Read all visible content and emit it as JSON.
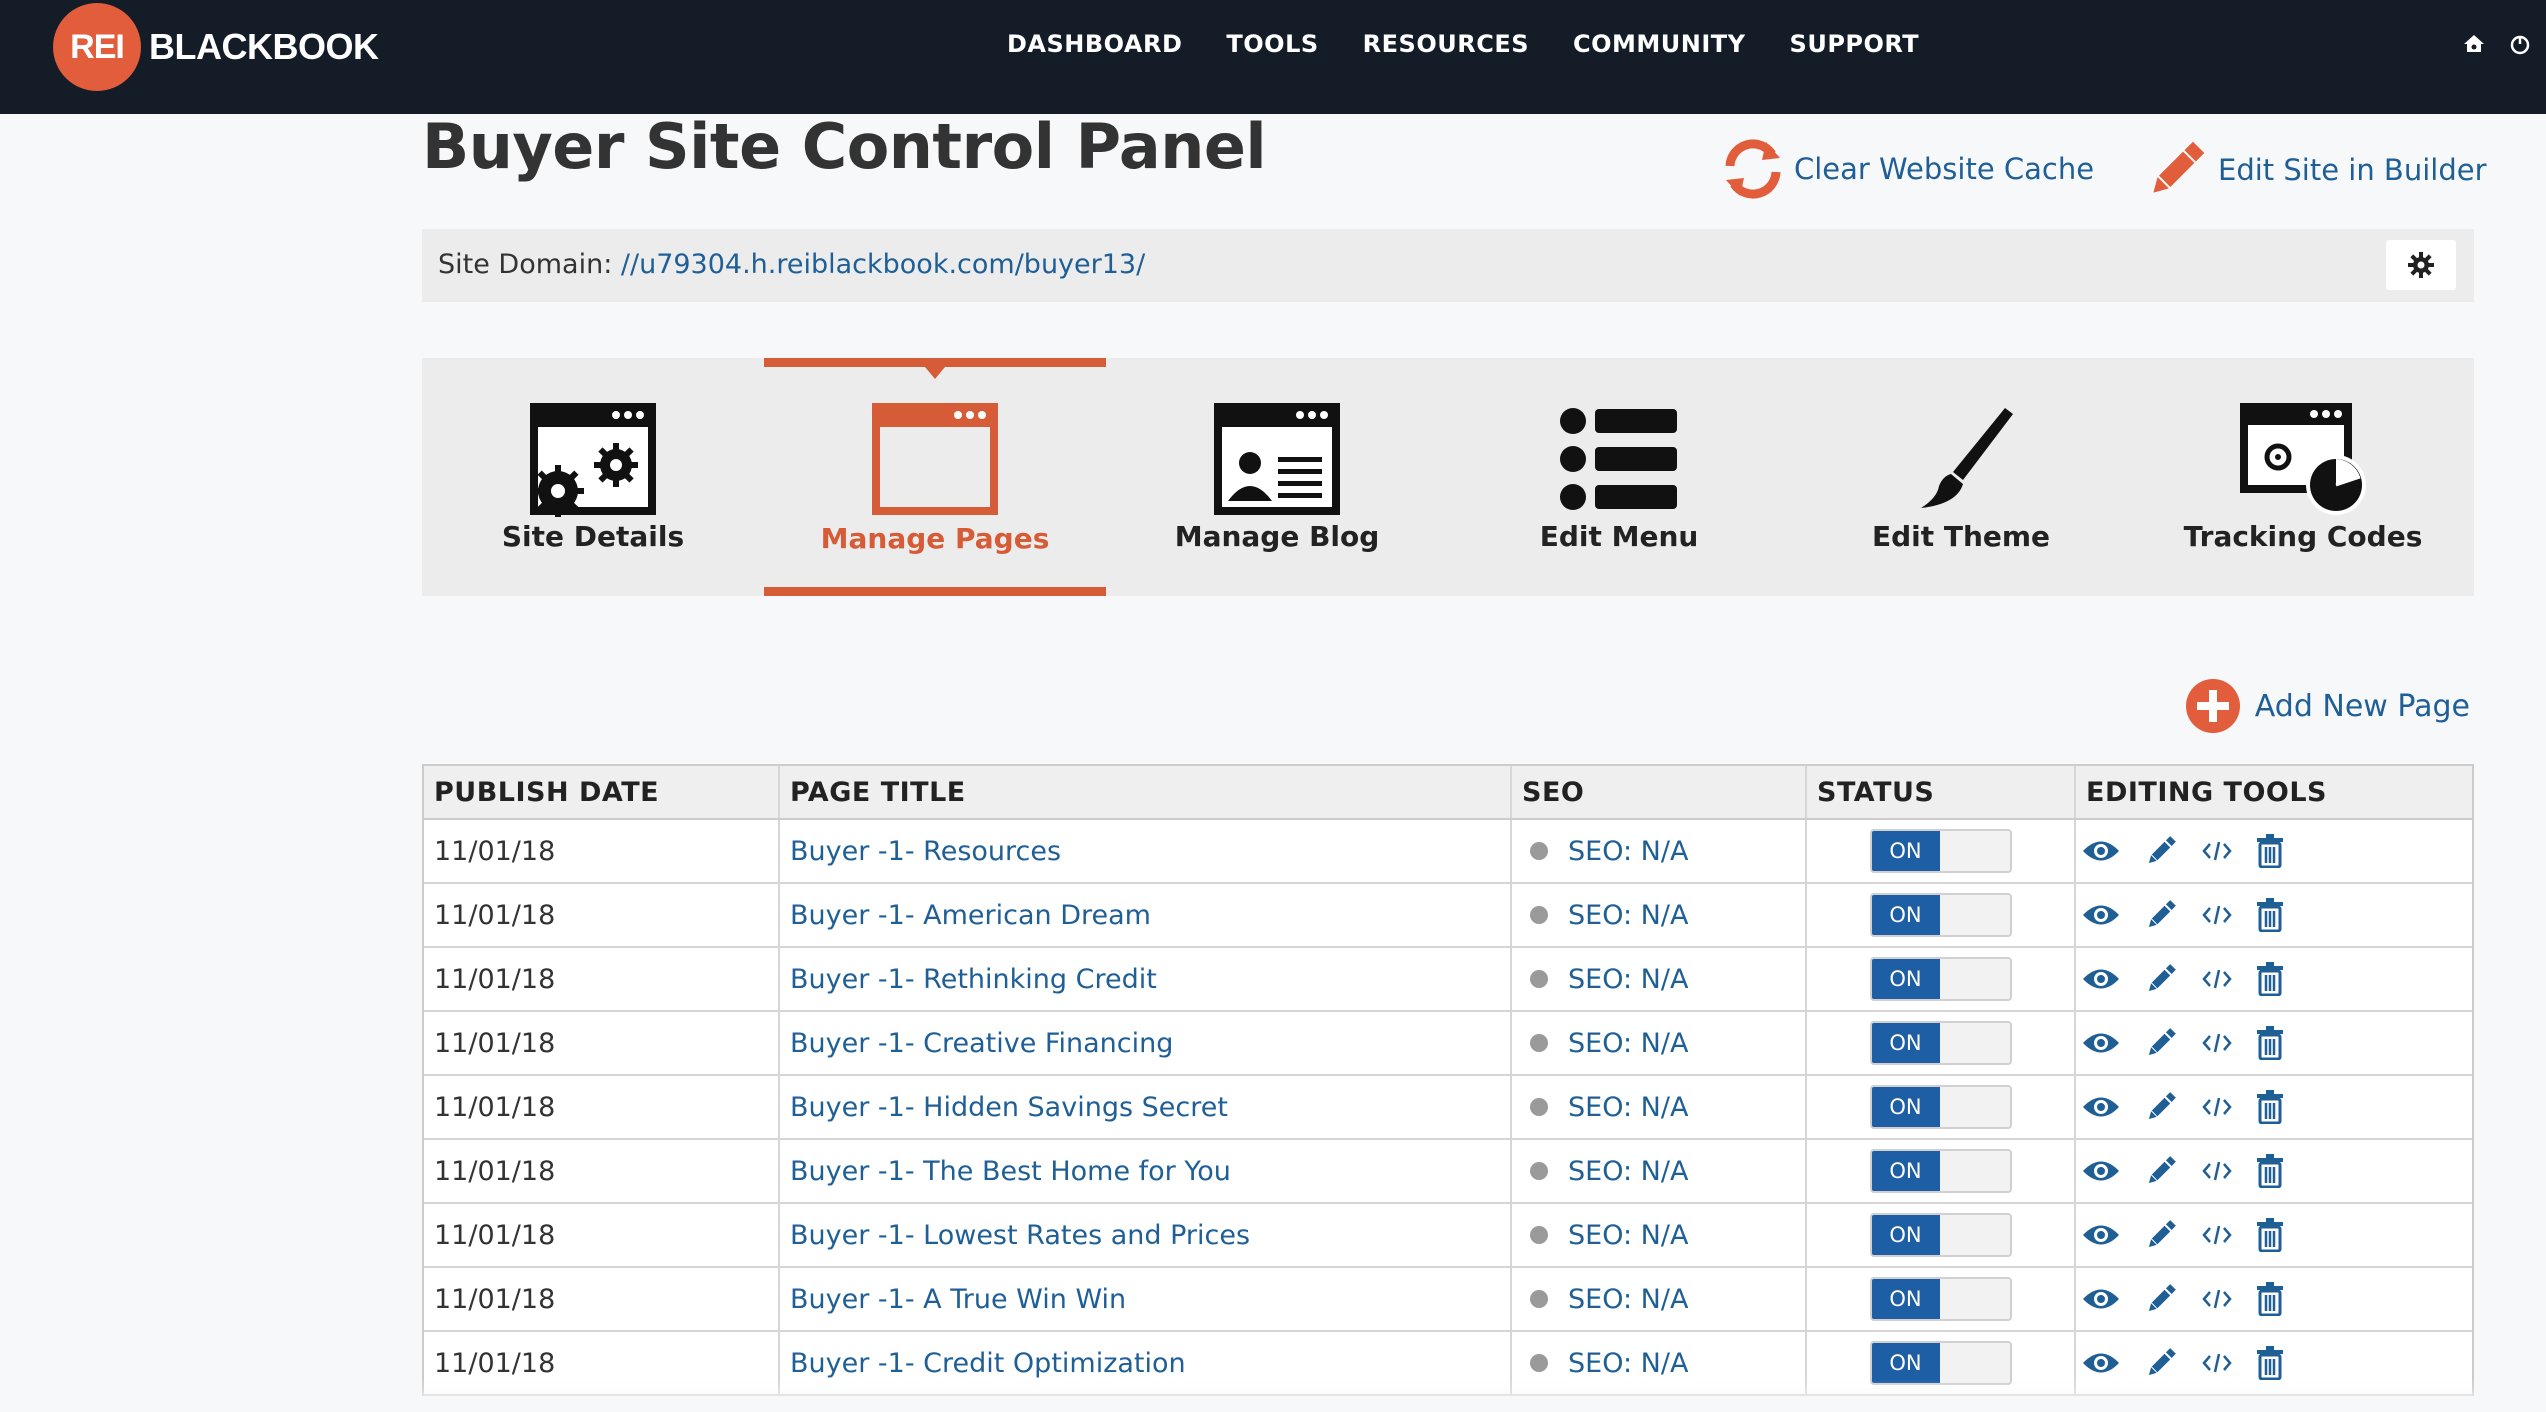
{
  "brand": {
    "badge": "REI",
    "wordmark": "BLACKBOOK",
    "accent": "#e15d3c",
    "nav_bg": "#131c27"
  },
  "nav": {
    "items": [
      "DASHBOARD",
      "TOOLS",
      "RESOURCES",
      "COMMUNITY",
      "SUPPORT"
    ]
  },
  "header": {
    "title": "Buyer Site Control Panel",
    "clear_cache": "Clear Website Cache",
    "edit_builder": "Edit Site in Builder"
  },
  "domain": {
    "label": "Site Domain:",
    "url": "//u79304.h.reiblackbook.com/buyer13/"
  },
  "tabs": [
    {
      "label": "Site Details",
      "icon": "browser-gears-icon",
      "active": false
    },
    {
      "label": "Manage Pages",
      "icon": "browser-window-icon",
      "active": true
    },
    {
      "label": "Manage Blog",
      "icon": "browser-profile-icon",
      "active": false
    },
    {
      "label": "Edit Menu",
      "icon": "list-icon",
      "active": false
    },
    {
      "label": "Edit Theme",
      "icon": "paintbrush-icon",
      "active": false
    },
    {
      "label": "Tracking Codes",
      "icon": "browser-chart-icon",
      "active": false
    }
  ],
  "add_page": "Add New Page",
  "table": {
    "headers": [
      "PUBLISH DATE",
      "PAGE TITLE",
      "SEO",
      "STATUS",
      "EDITING TOOLS"
    ],
    "rows": [
      {
        "date": "11/01/18",
        "title": "Buyer -1- Resources",
        "seo": "SEO: N/A",
        "status": "ON"
      },
      {
        "date": "11/01/18",
        "title": "Buyer -1- American Dream",
        "seo": "SEO: N/A",
        "status": "ON"
      },
      {
        "date": "11/01/18",
        "title": "Buyer -1- Rethinking Credit",
        "seo": "SEO: N/A",
        "status": "ON"
      },
      {
        "date": "11/01/18",
        "title": "Buyer -1- Creative Financing",
        "seo": "SEO: N/A",
        "status": "ON"
      },
      {
        "date": "11/01/18",
        "title": "Buyer -1- Hidden Savings Secret",
        "seo": "SEO: N/A",
        "status": "ON"
      },
      {
        "date": "11/01/18",
        "title": "Buyer -1- The Best Home for You",
        "seo": "SEO: N/A",
        "status": "ON"
      },
      {
        "date": "11/01/18",
        "title": "Buyer -1- Lowest Rates and Prices",
        "seo": "SEO: N/A",
        "status": "ON"
      },
      {
        "date": "11/01/18",
        "title": "Buyer -1- A True Win Win",
        "seo": "SEO: N/A",
        "status": "ON"
      },
      {
        "date": "11/01/18",
        "title": "Buyer -1- Credit Optimization",
        "seo": "SEO: N/A",
        "status": "ON"
      }
    ]
  },
  "colors": {
    "link": "#1f5f96",
    "toggle_on": "#1d5ea4",
    "active_tab": "#d65c37"
  }
}
